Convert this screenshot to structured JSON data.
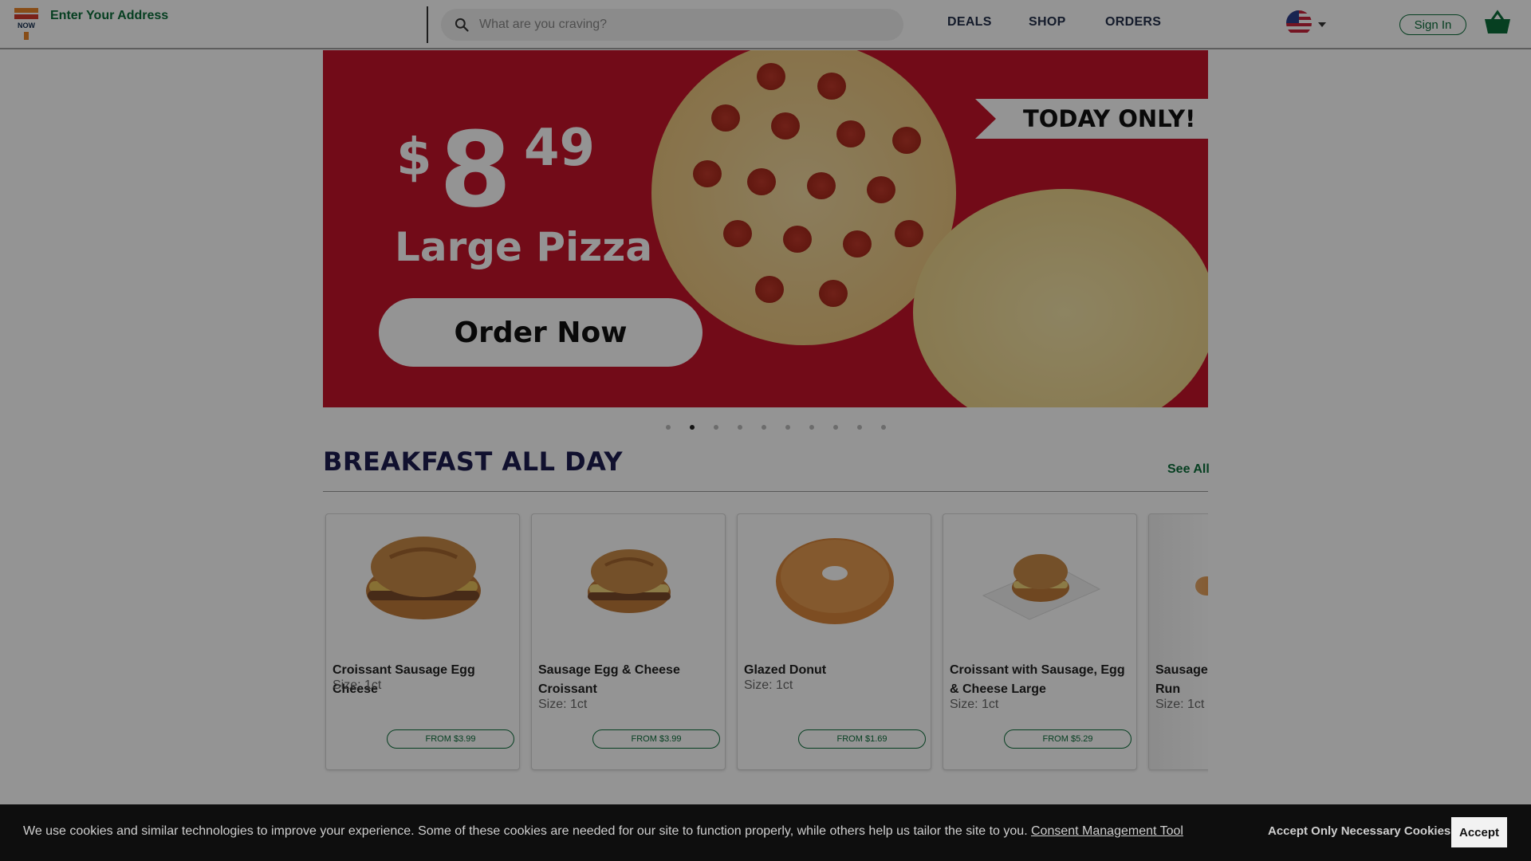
{
  "header": {
    "address_label": "Enter Your Address",
    "logo_text": "NOW",
    "search_placeholder": "What are you craving?",
    "nav": [
      "DEALS",
      "SHOP",
      "ORDERS"
    ],
    "sign_in": "Sign In"
  },
  "hero": {
    "price_dollar": "$",
    "price_main": "8",
    "price_cents": "49",
    "subtitle": "Large Pizza",
    "cta": "Order Now",
    "ribbon": "TODAY ONLY!",
    "slide_count": 10,
    "active_slide": 2
  },
  "section": {
    "title": "BREAKFAST ALL DAY",
    "see_all": "See All"
  },
  "products": [
    {
      "name": "Croissant Sausage Egg Cheese",
      "size": "Size: 1ct",
      "price": "FROM $3.99"
    },
    {
      "name": "Sausage Egg & Cheese Croissant",
      "size": "Size: 1ct",
      "price": "FROM $3.99"
    },
    {
      "name": "Glazed Donut",
      "size": "Size: 1ct",
      "price": "FROM $1.69"
    },
    {
      "name": "Croissant with Sausage, Egg & Cheese Large",
      "size": "Size: 1ct",
      "price": "FROM $5.29"
    },
    {
      "name": "Sausage Run",
      "size": "Size: 1ct"
    }
  ],
  "cookie": {
    "message": "We use cookies and similar technologies to improve your experience. Some of these cookies are needed for our site to function properly, while others help us tailor the site to you.",
    "link": "Consent Management Tool",
    "necessary": "Accept Only Necessary Cookies",
    "accept": "Accept"
  },
  "colors": {
    "brand_green": "#0b6d3a",
    "hero_red": "#c4142a",
    "title_navy": "#1c1c50"
  }
}
